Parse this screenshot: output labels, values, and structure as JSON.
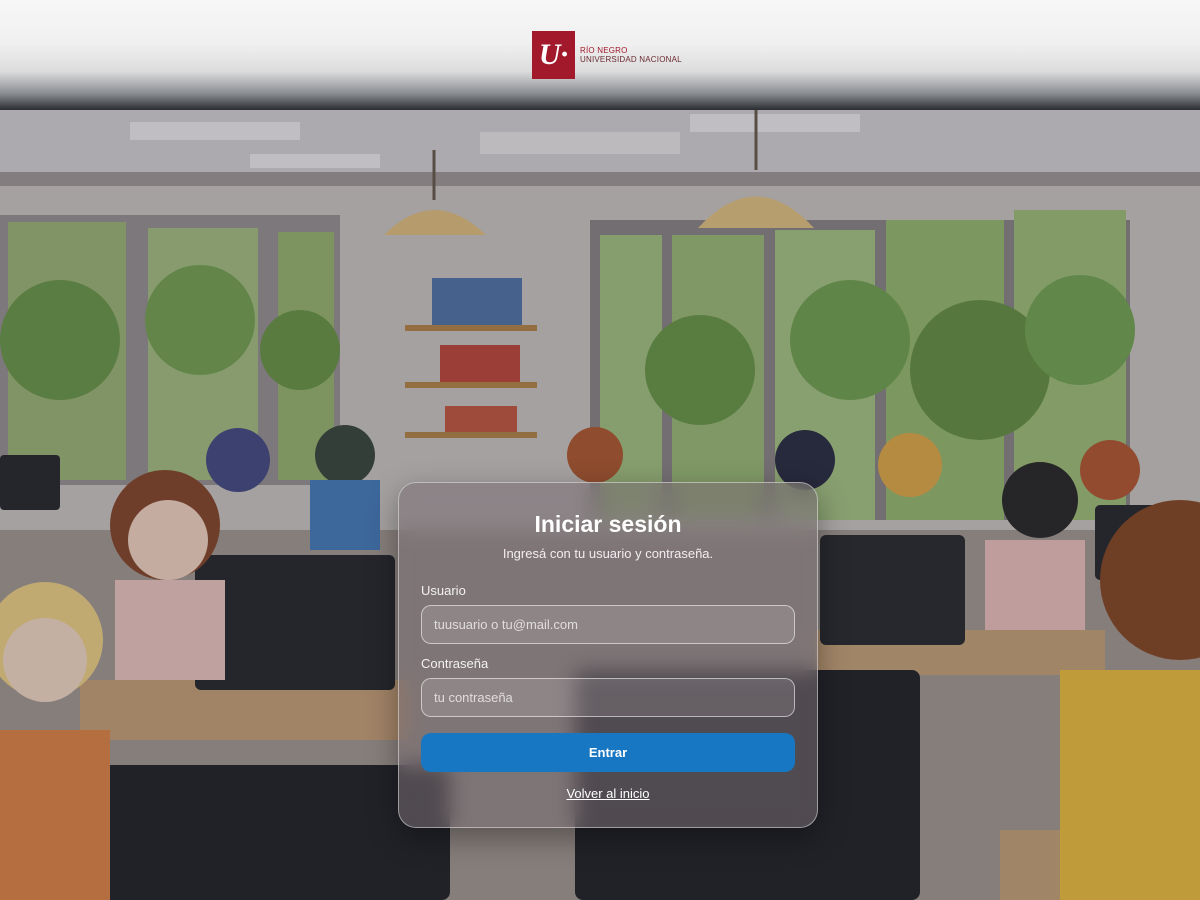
{
  "header": {
    "logo_mark": "U·",
    "logo_line1": "RÍO NEGRO",
    "logo_line2": "UNIVERSIDAD NACIONAL",
    "brand_color": "#a1192a"
  },
  "login": {
    "title": "Iniciar sesión",
    "subtitle": "Ingresá con tu usuario y contraseña.",
    "username_label": "Usuario",
    "username_placeholder": "tuusuario o tu@mail.com",
    "username_value": "",
    "password_label": "Contraseña",
    "password_placeholder": "tu contraseña",
    "password_value": "",
    "submit_label": "Entrar",
    "back_link": "Volver al inicio",
    "accent_color": "#1877c2"
  },
  "background": {
    "icon": "classroom-illustration"
  }
}
